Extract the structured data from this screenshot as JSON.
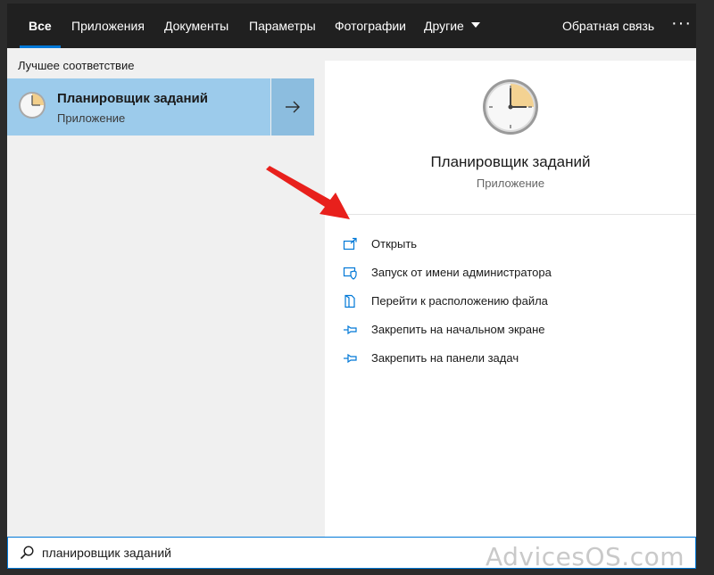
{
  "tabs": [
    {
      "label": "Все",
      "active": true
    },
    {
      "label": "Приложения"
    },
    {
      "label": "Документы"
    },
    {
      "label": "Параметры"
    },
    {
      "label": "Фотографии"
    },
    {
      "label": "Другие"
    }
  ],
  "feedback_label": "Обратная связь",
  "more_label": "···",
  "best_match": {
    "section_label": "Лучшее соответствие",
    "title": "Планировщик заданий",
    "subtitle": "Приложение",
    "icon": "clock-icon"
  },
  "detail": {
    "title": "Планировщик заданий",
    "subtitle": "Приложение",
    "actions": [
      {
        "label": "Открыть",
        "icon": "open-icon"
      },
      {
        "label": "Запуск от имени администратора",
        "icon": "admin-shield-icon"
      },
      {
        "label": "Перейти к расположению файла",
        "icon": "file-location-icon"
      },
      {
        "label": "Закрепить на начальном экране",
        "icon": "pin-icon"
      },
      {
        "label": "Закрепить на панели задач",
        "icon": "pin-icon"
      }
    ]
  },
  "search": {
    "value": "планировщик заданий"
  },
  "watermark": "AdvicesOS.com",
  "colors": {
    "accent": "#0078d7",
    "selected": "#9ccbeb",
    "topbar": "#202020",
    "annotation": "#e8201c"
  }
}
